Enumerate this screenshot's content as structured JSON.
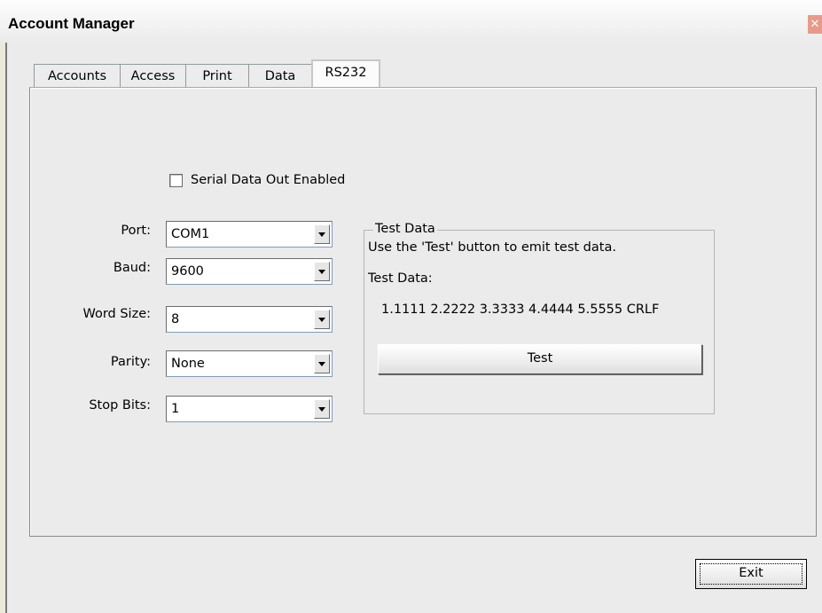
{
  "window": {
    "title": "Account Manager",
    "close_glyph": "✕"
  },
  "tabs": [
    {
      "label": "Accounts",
      "active": false
    },
    {
      "label": "Access",
      "active": false
    },
    {
      "label": "Print",
      "active": false
    },
    {
      "label": "Data",
      "active": false
    },
    {
      "label": "RS232",
      "active": true
    }
  ],
  "rs232": {
    "serial_enabled": {
      "label": "Serial Data Out Enabled",
      "checked": false
    },
    "fields": [
      {
        "label": "Port:",
        "value": "COM1"
      },
      {
        "label": "Baud:",
        "value": "9600"
      },
      {
        "label": "Word Size:",
        "value": "8"
      },
      {
        "label": "Parity:",
        "value": "None"
      },
      {
        "label": "Stop Bits:",
        "value": "1"
      }
    ],
    "test_group": {
      "legend": "Test Data",
      "instructions": "Use the 'Test' button to emit test data.",
      "data_label": "Test Data:",
      "data_value": "1.1111 2.2222 3.3333 4.4444 5.5555 CRLF",
      "button_label": "Test"
    }
  },
  "footer": {
    "exit_label": "Exit"
  },
  "colors": {
    "background": "#ebebeb",
    "close_button": "#e89a8a"
  }
}
